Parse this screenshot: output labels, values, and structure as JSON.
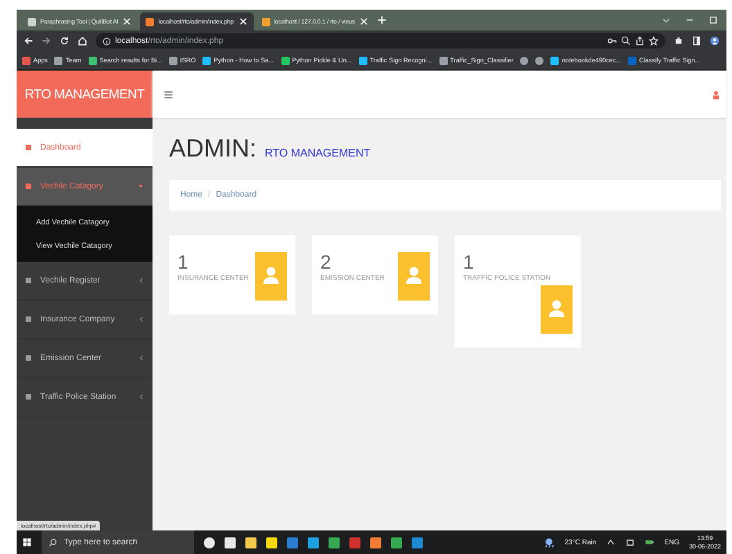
{
  "browser": {
    "tabs": [
      {
        "title": "Paraphrasing Tool | QuillBot AI",
        "selected": false,
        "color": "#c9d3c9"
      },
      {
        "title": "localhost/rto/admin/index.php",
        "selected": true,
        "color": "#f07a2e"
      },
      {
        "title": "localhost / 127.0.0.1 / rto / vieus",
        "selected": false,
        "color": "#f0a030"
      }
    ],
    "address": {
      "host": "localhost",
      "path": "/rto/admin/index.php"
    },
    "bookmarks": [
      {
        "label": "Apps",
        "color": "#e8554e"
      },
      {
        "label": "Team",
        "color": "#9aa0a6"
      },
      {
        "label": "Search results for Bi...",
        "color": "#3fbf6f"
      },
      {
        "label": "ISRO",
        "color": "#9aa0a6"
      },
      {
        "label": "Python - How to Sa...",
        "color": "#20beff"
      },
      {
        "label": "Python Pickle & Un...",
        "color": "#22c55e"
      },
      {
        "label": "Traffic Sign Recogni...",
        "color": "#20beff"
      },
      {
        "label": "Traffic_Sign_Classifier",
        "color": "#9aa0a6"
      },
      {
        "color": "#9aa0a6"
      },
      {
        "color": "#9aa0a6"
      },
      {
        "label": "notebookde490cec...",
        "color": "#20beff"
      },
      {
        "label": "Classify Traffic Sign...",
        "color": "#0a66c2"
      }
    ]
  },
  "app": {
    "logo": "RTO MANAGEMENT",
    "sidebar": [
      {
        "label": "Dashboard",
        "kind": "link",
        "selected": true,
        "expanded": false
      },
      {
        "label": "Vechile Catagory",
        "kind": "menu",
        "selected": false,
        "expanded": true,
        "children": [
          "Add Vechile Catagory",
          "View Vechile Catagory"
        ]
      },
      {
        "label": "Vechile Register",
        "kind": "menu",
        "selected": false,
        "expanded": false
      },
      {
        "label": "Insurance Company",
        "kind": "menu",
        "selected": false,
        "expanded": false
      },
      {
        "label": "Emission Center",
        "kind": "menu",
        "selected": false,
        "expanded": false
      },
      {
        "label": "Traffic Police Station",
        "kind": "menu",
        "selected": false,
        "expanded": false
      }
    ],
    "heading": {
      "title": "ADMIN:",
      "subtitle": "RTO MANAGEMENT"
    },
    "breadcrumb": [
      "Home",
      "/",
      "Dashboard"
    ],
    "cards": [
      {
        "count": "1",
        "label": "INSURANCE CENTER"
      },
      {
        "count": "2",
        "label": "EMISSION CENTER"
      },
      {
        "count": "1",
        "label": "TRAFFIC POLICE STATION"
      }
    ],
    "status_url": "localhost/rto/admin/index.php#"
  },
  "taskbar": {
    "search": {
      "placeholder": "Type here to search"
    },
    "apps": [
      {
        "color": "#e8e8e8"
      },
      {
        "color": "#e8e8e8"
      },
      {
        "color": "#f2c94c"
      },
      {
        "color": "#f5d90a"
      },
      {
        "color": "#2b7cd3"
      },
      {
        "color": "#1fa1e0"
      },
      {
        "color": "#34a853"
      },
      {
        "color": "#d0312d"
      },
      {
        "color": "#f27b35"
      },
      {
        "color": "#34a853"
      },
      {
        "color": "#1f8ad2"
      }
    ],
    "weather": "23°C Rain",
    "language": "ENG",
    "time": "13:59",
    "date": "30-06-2022"
  }
}
